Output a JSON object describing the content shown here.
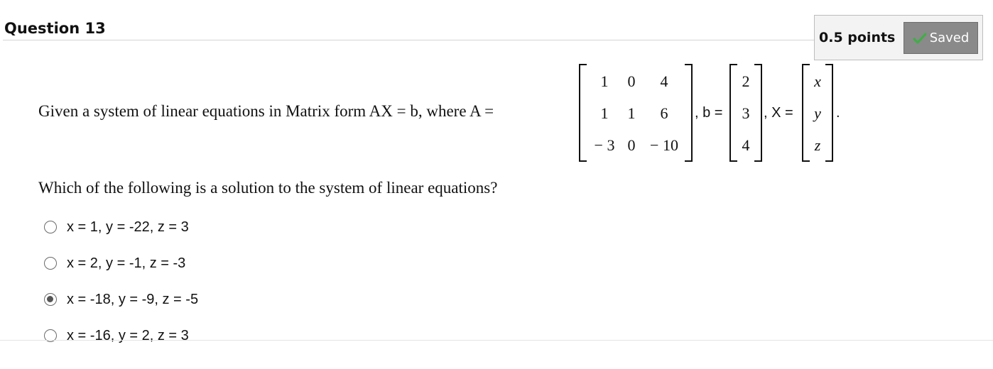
{
  "question": {
    "title": "Question 13",
    "points": "0.5 points",
    "status": {
      "label": "Saved",
      "icon": "check-icon",
      "icon_color": "#3cb043"
    }
  },
  "prompt": {
    "intro": "Given a system of linear equations in Matrix form AX = b, where A =",
    "b_label": ", b =",
    "x_label": ", X =",
    "end": "."
  },
  "matrix_A": [
    [
      "1",
      "0",
      "4"
    ],
    [
      "1",
      "1",
      "6"
    ],
    [
      "− 3",
      "0",
      "− 10"
    ]
  ],
  "vector_b": [
    "2",
    "3",
    "4"
  ],
  "vector_X": [
    "x",
    "y",
    "z"
  ],
  "ask": "Which of the following is a solution to the system of linear equations?",
  "options": [
    {
      "label": "x = 1, y = -22, z = 3",
      "selected": false
    },
    {
      "label": "x = 2, y = -1, z = -3",
      "selected": false
    },
    {
      "label": "x = -18, y = -9, z = -5",
      "selected": true
    },
    {
      "label": "x = -16, y = 2, z = 3",
      "selected": false
    }
  ]
}
